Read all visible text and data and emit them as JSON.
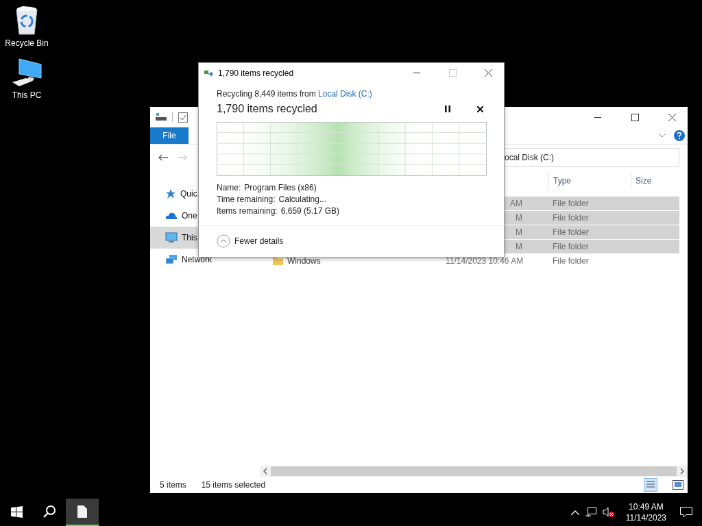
{
  "desktop_icons": [
    {
      "label": "Recycle Bin",
      "kind": "recycle-bin"
    },
    {
      "label": "This PC",
      "kind": "computer"
    }
  ],
  "explorer": {
    "ribbon_tab": "File",
    "address": "ocal Disk (C:)",
    "nav_items": [
      {
        "label": "Quic",
        "kind": "star",
        "selected": false
      },
      {
        "label": "One",
        "kind": "cloud",
        "selected": false
      },
      {
        "label": "This",
        "kind": "computer",
        "selected": true
      },
      {
        "label": "Network",
        "kind": "network",
        "selected": false
      }
    ],
    "columns": [
      "Type",
      "Size"
    ],
    "rows": [
      {
        "date": "AM",
        "type": "File folder",
        "selected": true
      },
      {
        "date": "M",
        "type": "File folder",
        "selected": true
      },
      {
        "date": "M",
        "type": "File folder",
        "selected": true
      },
      {
        "date": "M",
        "type": "File folder",
        "selected": true
      },
      {
        "name": "Windows",
        "date": "11/14/2023 10:46 AM",
        "type": "File folder",
        "selected": false
      }
    ],
    "status": {
      "count": "5 items",
      "selection": "15 items selected"
    }
  },
  "dialog": {
    "title": "1,790 items recycled",
    "summary": "Recycling 8,449 items from ",
    "source_link": "Local Disk (C:)",
    "heading": "1,790 items recycled",
    "details": [
      {
        "label": "Name:",
        "value": "Program Files (x86)"
      },
      {
        "label": "Time remaining:",
        "value": "Calculating..."
      },
      {
        "label": "Items remaining:",
        "value": "6,659 (5.17 GB)"
      }
    ],
    "toggle": "Fewer details"
  },
  "taskbar": {
    "apps": [
      {
        "kind": "file",
        "active": true
      }
    ],
    "time": "10:49 AM",
    "date": "11/14/2023"
  }
}
